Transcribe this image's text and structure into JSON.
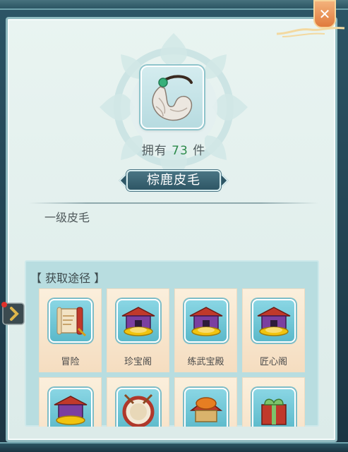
{
  "item": {
    "owned_prefix": "拥有",
    "owned_count": "73",
    "owned_suffix": "件",
    "name": "棕鹿皮毛",
    "description": "一级皮毛",
    "icon": "fur-icon"
  },
  "source": {
    "title": "【 获取途径 】",
    "items": [
      {
        "label": "冒险",
        "icon": "scroll-icon"
      },
      {
        "label": "珍宝阁",
        "icon": "treasure-pavilion-icon"
      },
      {
        "label": "练武宝殿",
        "icon": "treasure-pavilion-icon"
      },
      {
        "label": "匠心阁",
        "icon": "treasure-pavilion-icon"
      },
      {
        "label": "",
        "icon": "treasure-pavilion-icon"
      },
      {
        "label": "",
        "icon": "drum-icon"
      },
      {
        "label": "",
        "icon": "fish-lantern-icon"
      },
      {
        "label": "",
        "icon": "gift-box-icon"
      }
    ]
  },
  "close_icon": "close-icon",
  "colors": {
    "accent": "#2e5665",
    "count_green": "#2c8a4a",
    "close_orange": "#e07a3c"
  }
}
